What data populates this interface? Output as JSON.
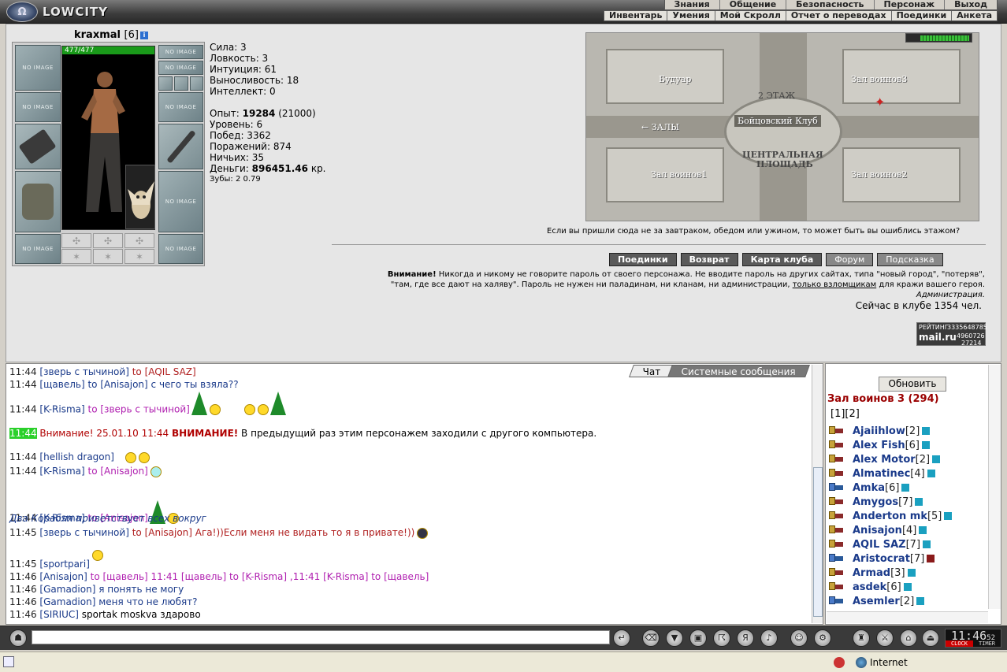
{
  "app": {
    "logo": "LOWCITY",
    "emblem": "Ω"
  },
  "menu_top": [
    "Знания",
    "Общение",
    "Безопасность",
    "Персонаж",
    "Выход"
  ],
  "menu_sub": [
    "Инвентарь",
    "Умения",
    "Мой Скролл",
    "Отчет о переводах",
    "Поединки",
    "Анкета"
  ],
  "character": {
    "name": "kraxmal",
    "level": "[6]",
    "hp": "477/477",
    "no_image": "NO IMAGE",
    "stats": {
      "strength": "Сила: 3",
      "agility": "Ловкость: 3",
      "intuition": "Интуиция: 61",
      "endurance": "Выносливость: 18",
      "intellect": "Интеллект: 0"
    },
    "exp_label": "Опыт: ",
    "exp": "19284",
    "exp_next": " (21000)",
    "level_line": "Уровень: 6",
    "wins": "Побед: 3362",
    "losses": "Поражений: 874",
    "draws": "Ничьих: 35",
    "money_label": "Деньги: ",
    "money": "896451.46",
    "money_unit": " кр.",
    "teeth": "Зубы: 2 0.79"
  },
  "map": {
    "boudoir": "Будуар",
    "warriors3": "Зал воинов3",
    "floor2": "2 ЭТАЖ",
    "club": "Бойцовский Клуб",
    "halls": "← ЗАЛЫ",
    "central": "ЦЕНТРАЛЬНАЯ",
    "square": "ПЛОЩАДЬ",
    "warriors1": "Зал воинов1",
    "warriors2": "Зал воинов2"
  },
  "map_message": "Если вы пришли сюда не за завтраком, обедом или ужином, то может быть вы ошиблись этажом?",
  "buttons": [
    "Поединки",
    "Возврат",
    "Карта клуба",
    "Форум",
    "Подсказка"
  ],
  "warning": {
    "bold": "Внимание!",
    "line1": " Никогда и никому не говорите пароль от своего персонажа. Не вводите пароль на других сайтах, типа \"новый город\", \"потеряв\",",
    "line2a": "\"там, где все дают на халяву\". Пароль не нужен ни паладинам, ни кланам, ни администрации, ",
    "link": "только взломщикам",
    "line2b": " для кражи вашего героя.",
    "sign": "Администрация."
  },
  "online": "Сейчас в клубе 1354 чел.",
  "counter": {
    "brand": "mail.ru",
    "rating": "РЕЙТИНГ",
    "n1": "3335648785",
    "n2": "4960726",
    "n3": "27214"
  },
  "chat_tabs": {
    "chat": "Чат",
    "system": "Системные сообщения"
  },
  "chat": [
    {
      "time": "11:44",
      "nick": "[зверь с тычиной]",
      "to": " to [AQIL SAZ]",
      "text": ""
    },
    {
      "time": "11:44",
      "nick": "[щавель]",
      "to": "",
      "text": " to [Anisajon] с чего ты взяла??"
    },
    {
      "time": "11:44",
      "nick": "[K-Risma]",
      "to": " to [зверь с тычиной]",
      "text": ""
    },
    {
      "time": "11:44",
      "sys": "Внимание! 25.01.10 11:44 ",
      "sysbold": "ВНИМАНИЕ!",
      "text": " В предыдущий раз этим персонажем заходили с другого компьютера."
    },
    {
      "time": "11:44",
      "nick": "[hellish dragon]",
      "to": "",
      "text": ""
    },
    {
      "time": "11:44",
      "nick": "[K-Risma]",
      "to": " to [Anisajon]",
      "text": ""
    },
    {
      "time": "11:44",
      "nick": "[K-Risma]",
      "to": " to [Anisajon]",
      "text": ""
    },
    {
      "time": "11:45",
      "ital": "Два Корабля приветствует всех вокруг"
    },
    {
      "time": "11:45",
      "nick": "[зверь с тычиной]",
      "to": " to [Anisajon] Ага!))Если меня не видать то я в привате!))",
      "text": ""
    },
    {
      "time": "11:45",
      "nick": "[sportpari]",
      "to": "",
      "text": ""
    },
    {
      "time": "11:46",
      "nick": "[Anisajon]",
      "to": " to [щавель] 11:41 [щавель] to [K-Risma] ,11:41 [K-Risma] to [щавель]",
      "text": ""
    },
    {
      "time": "11:46",
      "nick": "[Gamadion]",
      "to": "",
      "text": " я понять не могу"
    },
    {
      "time": "11:46",
      "nick": "[Gamadion]",
      "to": "",
      "text": " меня что не любят?"
    },
    {
      "time": "11:46",
      "nick": "[SIRIUC]",
      "to": "",
      "text": " sportak moskva здарово"
    }
  ],
  "right_panel": {
    "refresh": "Обновить",
    "room": "Зал воинов 3 (294)",
    "pages": "[1][2]",
    "users": [
      {
        "name": "Ajaiihlow",
        "lvl": "[2]",
        "alt": false
      },
      {
        "name": "Alex Fish",
        "lvl": "[6]",
        "alt": false
      },
      {
        "name": "Alex Motor",
        "lvl": "[2]",
        "alt": false
      },
      {
        "name": "Almatinec",
        "lvl": "[4]",
        "alt": false
      },
      {
        "name": "Amka",
        "lvl": "[6]",
        "alt": true
      },
      {
        "name": "Amygos",
        "lvl": "[7]",
        "alt": false
      },
      {
        "name": "Anderton mk",
        "lvl": "[5]",
        "alt": false
      },
      {
        "name": "Anisajon",
        "lvl": "[4]",
        "alt": false
      },
      {
        "name": "AQIL SAZ",
        "lvl": "[7]",
        "alt": false
      },
      {
        "name": "Aristocrat",
        "lvl": "[7]",
        "alt": true,
        "red": true
      },
      {
        "name": "Armad",
        "lvl": "[3]",
        "alt": false
      },
      {
        "name": "asdek",
        "lvl": "[6]",
        "alt": false
      },
      {
        "name": "Asemler",
        "lvl": "[2]",
        "alt": true
      }
    ]
  },
  "clock": {
    "time": "11:46",
    "sec": "52",
    "clock_label": "CLOCK",
    "timer_label": "TIMER"
  },
  "statusbar": {
    "zone": "Internet"
  }
}
